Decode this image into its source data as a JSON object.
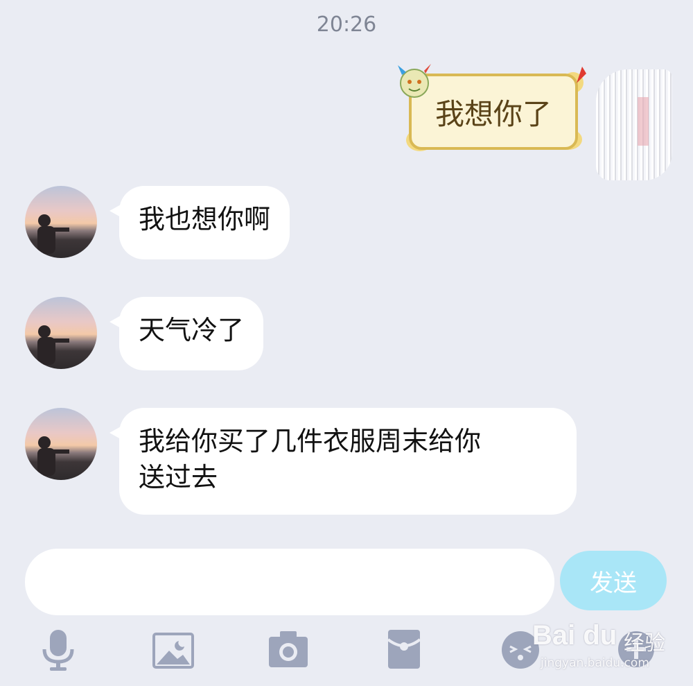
{
  "header": {
    "timestamp": "20:26"
  },
  "messages": {
    "sent": [
      {
        "text": "我想你了"
      }
    ],
    "received": [
      {
        "text": "我也想你啊"
      },
      {
        "text": "天气冷了"
      },
      {
        "text_line1": "我给你买了几件衣服周末给你",
        "text_line2": "送过去"
      }
    ]
  },
  "input": {
    "placeholder": "",
    "send_label": "发送"
  },
  "toolbar": [
    "microphone-icon",
    "image-icon",
    "camera-icon",
    "red-packet-icon",
    "emoji-icon",
    "plus-icon"
  ],
  "watermark": {
    "logo": "Bai du",
    "text": "经验",
    "url": "jingyan.baidu.com"
  },
  "colors": {
    "background": "#eaecf3",
    "bubble": "#ffffff",
    "send_button": "#a9e6f7",
    "icon": "#9da5bb"
  }
}
